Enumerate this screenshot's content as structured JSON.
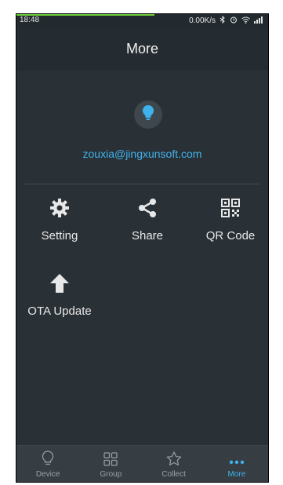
{
  "status_bar": {
    "time": "18:48",
    "network_speed": "0.00K/s",
    "icons": [
      "bluetooth-icon",
      "alarm-icon",
      "wifi-icon",
      "signal-icon"
    ]
  },
  "header": {
    "title": "More"
  },
  "profile": {
    "email": "zouxia@jingxunsoft.com",
    "avatar_icon": "bulb-icon"
  },
  "menu": [
    {
      "label": "Setting",
      "icon": "gear-icon"
    },
    {
      "label": "Share",
      "icon": "share-icon"
    },
    {
      "label": "QR Code",
      "icon": "qr-code-icon"
    },
    {
      "label": "OTA Update",
      "icon": "arrow-up-icon"
    }
  ],
  "tabs": [
    {
      "label": "Device",
      "icon": "bulb-outline-icon",
      "active": false
    },
    {
      "label": "Group",
      "icon": "grid-icon",
      "active": false
    },
    {
      "label": "Collect",
      "icon": "star-outline-icon",
      "active": false
    },
    {
      "label": "More",
      "icon": "dots-icon",
      "active": true
    }
  ],
  "colors": {
    "accent": "#3fb2ec",
    "background": "#2a3136",
    "tabbar": "#363e44"
  }
}
